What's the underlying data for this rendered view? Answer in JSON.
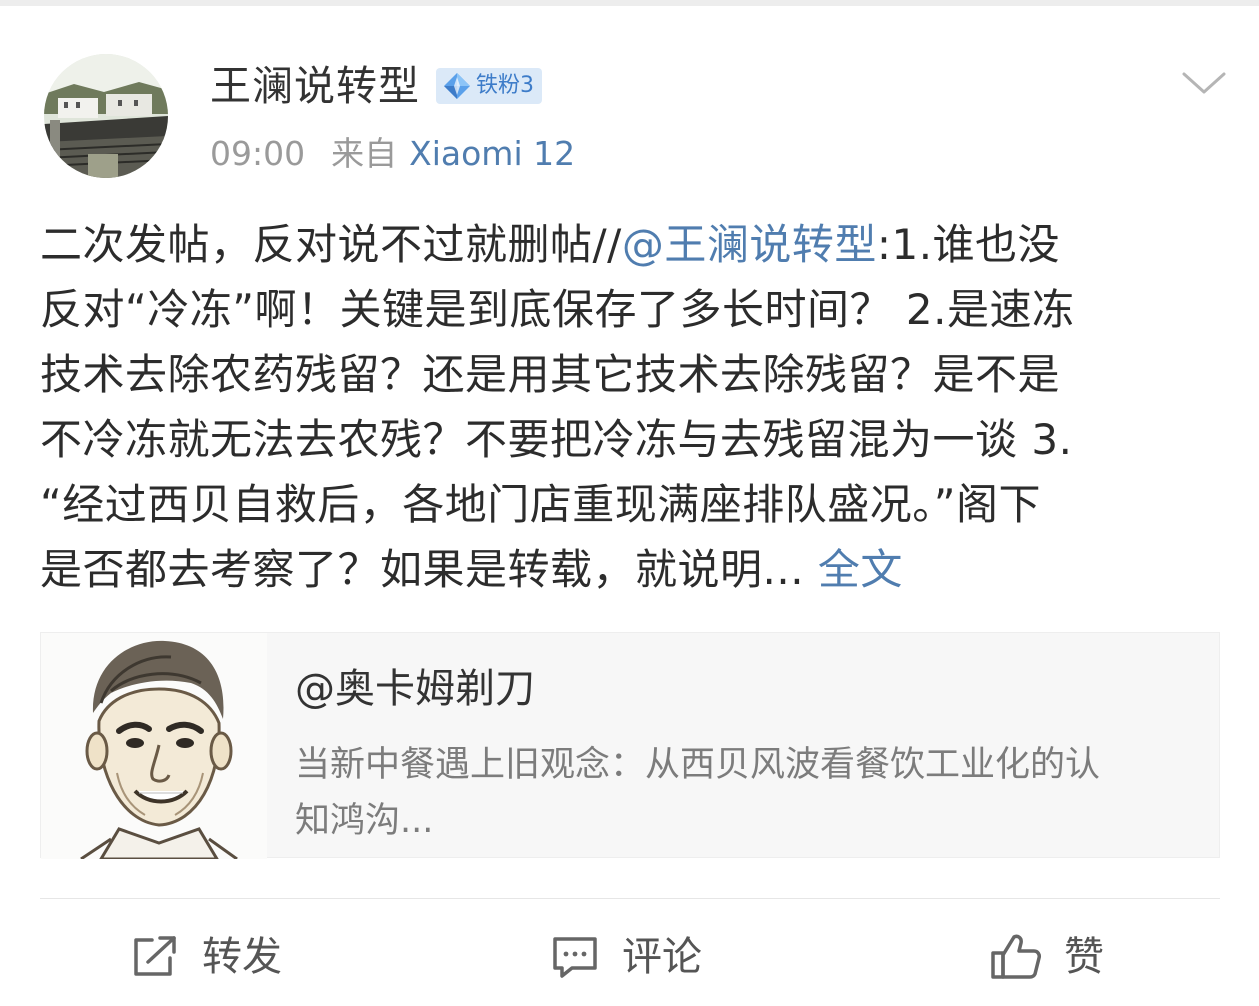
{
  "post": {
    "author": {
      "name": "王澜说转型",
      "fan_badge": "铁粉3"
    },
    "meta": {
      "time": "09:00",
      "source_prefix": "来自",
      "device": "Xiaomi 12"
    },
    "text_lines": [
      {
        "before": "二次发帖，反对说不过就删帖//",
        "mention": "@王澜说转型",
        "after": ":1.谁也没"
      },
      "反对“冷冻”啊！关键是到底保存了多长时间？ 2.是速冻",
      "技术去除农药残留？还是用其它技术去除残留？是不是",
      "不冷冻就无法去农残？不要把冷冻与去残留混为一谈 3.",
      "“经过西贝自救后，各地门店重现满座排队盛况。”阁下",
      {
        "before": "是否都去考察了？如果是转载，就说明...",
        "link": "全文"
      }
    ],
    "shared_card": {
      "title": "@奥卡姆剃刀",
      "summary_lines": [
        "当新中餐遇上旧观念：从西贝风波看餐饮工业化的认",
        "知鸿沟..."
      ]
    },
    "actions": {
      "repost": {
        "label": "转发",
        "icon": "share-icon"
      },
      "comment": {
        "label": "评论",
        "icon": "comment-icon"
      },
      "like": {
        "label": "赞",
        "icon": "thumbs-up-icon"
      }
    },
    "colors": {
      "link": "#507daf",
      "badge_bg": "#dbe9f8",
      "badge_text": "#3d7cc9",
      "meta_gray": "#9a9a9a",
      "card_bg": "#f7f7f7"
    }
  }
}
